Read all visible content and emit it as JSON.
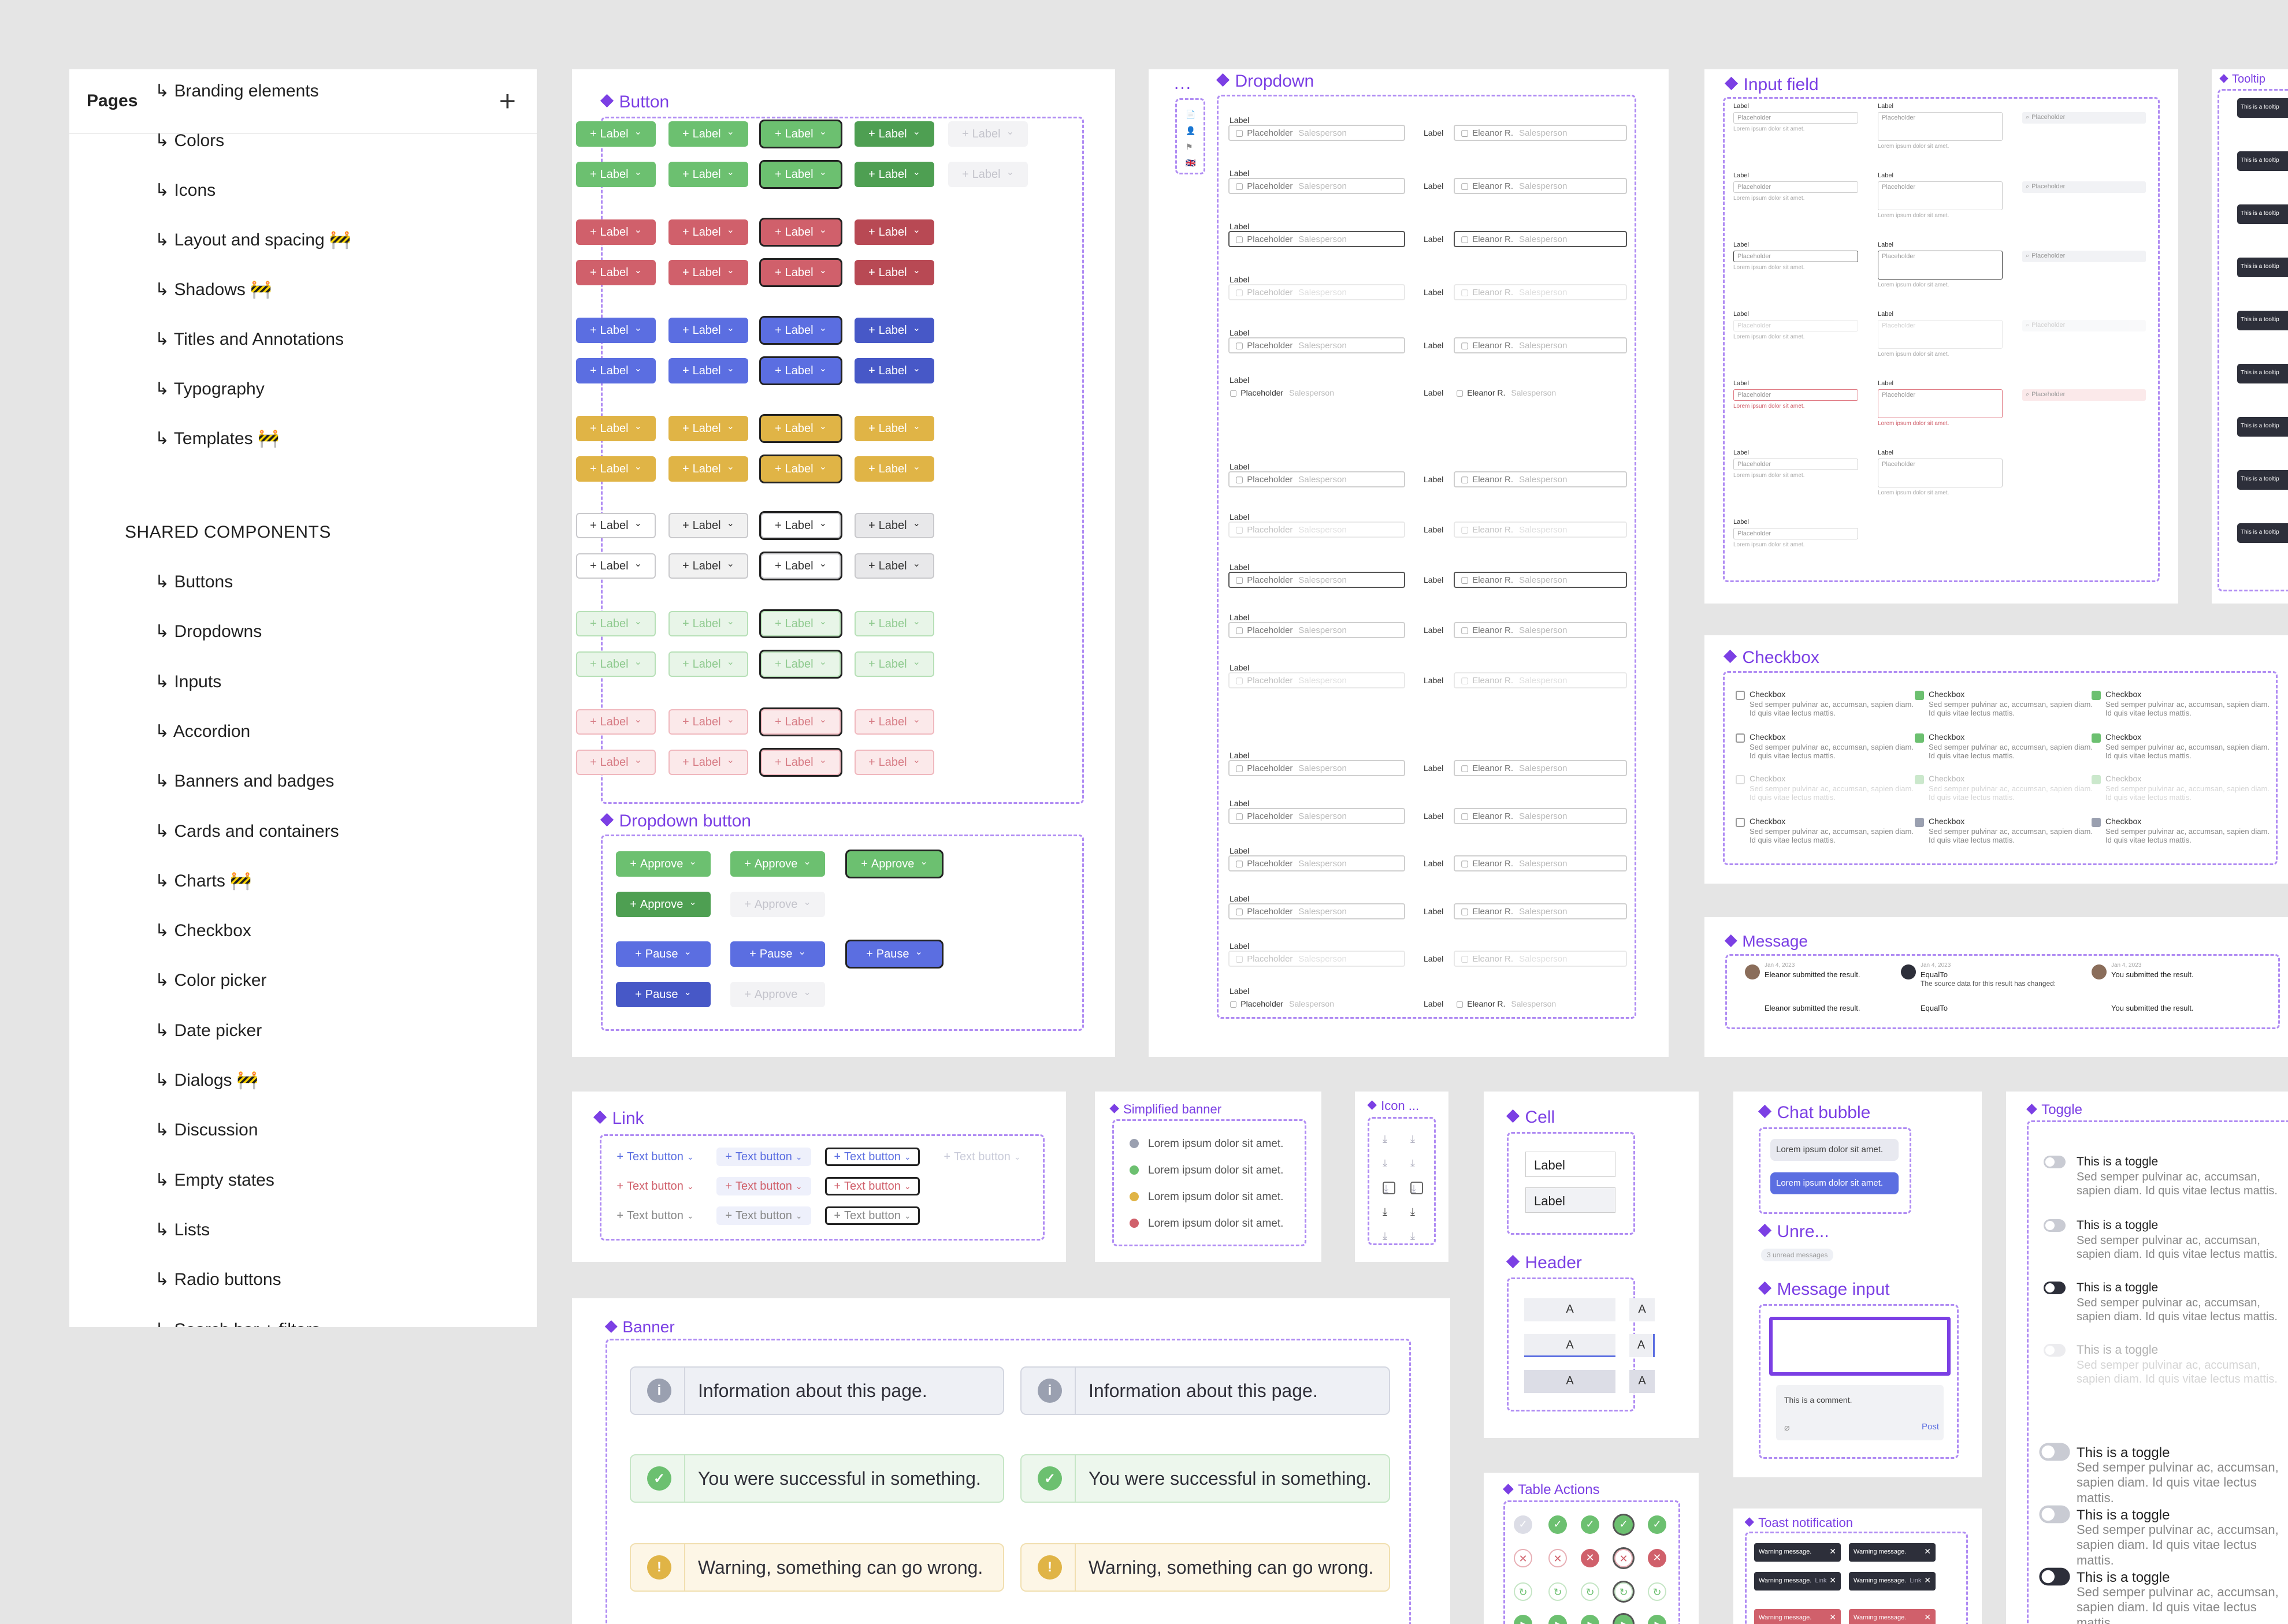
{
  "sidebar": {
    "title": "Pages",
    "add_icon": "plus-icon",
    "items": [
      {
        "label": "↳ Branding elements"
      },
      {
        "label": "↳ Colors"
      },
      {
        "label": "↳ Icons"
      },
      {
        "label": "↳ Layout and spacing 🚧"
      },
      {
        "label": "↳ Shadows 🚧"
      },
      {
        "label": "↳ Titles and Annotations"
      },
      {
        "label": "↳ Typography"
      },
      {
        "label": "↳ Templates 🚧"
      }
    ],
    "section": "SHARED COMPONENTS",
    "components": [
      "↳ Buttons",
      "↳ Dropdowns",
      "↳ Inputs",
      "↳ Accordion",
      "↳ Banners and badges",
      "↳ Cards and containers",
      "↳ Charts 🚧",
      "↳ Checkbox",
      "↳ Color picker",
      "↳ Date picker",
      "↳ Dialogs 🚧",
      "↳ Discussion",
      "↳ Empty states",
      "↳ Lists",
      "↳ Radio buttons",
      "↳ Search bar + filters"
    ]
  },
  "frames": {
    "button": "Button",
    "dropdown_button": "Dropdown button",
    "dropdown": "Dropdown",
    "input_field": "Input field",
    "tooltip": "Tooltip",
    "checkbox": "Checkbox",
    "message": "Message",
    "link": "Link",
    "simplified_banner": "Simplified banner",
    "icon": "Icon ...",
    "cell": "Cell",
    "header": "Header",
    "chat_bubble": "Chat bubble",
    "unread": "Unre...",
    "message_input": "Message input",
    "toggle": "Toggle",
    "banner": "Banner",
    "table_actions": "Table Actions",
    "toast": "Toast notification"
  },
  "button_label": "Label",
  "approve_label": "Approve",
  "pause_label": "Pause",
  "text_button": "Text button",
  "dropdown": {
    "label": "Label",
    "placeholder": "Placeholder",
    "salesperson": "Salesperson",
    "name": "Eleanor R."
  },
  "input": {
    "label": "Label",
    "placeholder": "Placeholder",
    "help": "Lorem ipsum dolor sit amet."
  },
  "checkbox": {
    "label": "Checkbox",
    "desc": "Sed semper pulvinar ac, accumsan, sapien diam. Id quis vitae lectus mattis."
  },
  "message": {
    "a_date": "Jan 4, 2023",
    "a_text": "Eleanor submitted the result.",
    "b_name": "EqualTo",
    "b_text": "The source data for this result has changed:",
    "c_text": "You submitted the result."
  },
  "simplified_banner": "Lorem ipsum dolor sit amet.",
  "cell": {
    "label": "Label",
    "header": "A"
  },
  "chat": {
    "text": "Lorem ipsum dolor sit amet.",
    "unread": "3 unread messages"
  },
  "msg_input": {
    "comment": "This is a comment.",
    "post": "Post"
  },
  "toggle": {
    "label": "This is a toggle",
    "desc": "Sed semper pulvinar ac, accumsan, sapien diam. Id quis vitae lectus mattis."
  },
  "tooltip": {
    "text": "This is a tooltip"
  },
  "toast": {
    "text": "Warning message.",
    "link": "Link"
  },
  "banner": {
    "info": "Information about this page.",
    "success": "You were successful in something.",
    "warning": "Warning, something can go wrong."
  },
  "colors": {
    "green": "#6cc070",
    "green_dark": "#4e9f52",
    "red": "#d0606b",
    "red_dark": "#b84954",
    "blue": "#5b6ee1",
    "blue_dark": "#4758c7",
    "yellow": "#e0b446",
    "purple": "#7b3fe4"
  }
}
